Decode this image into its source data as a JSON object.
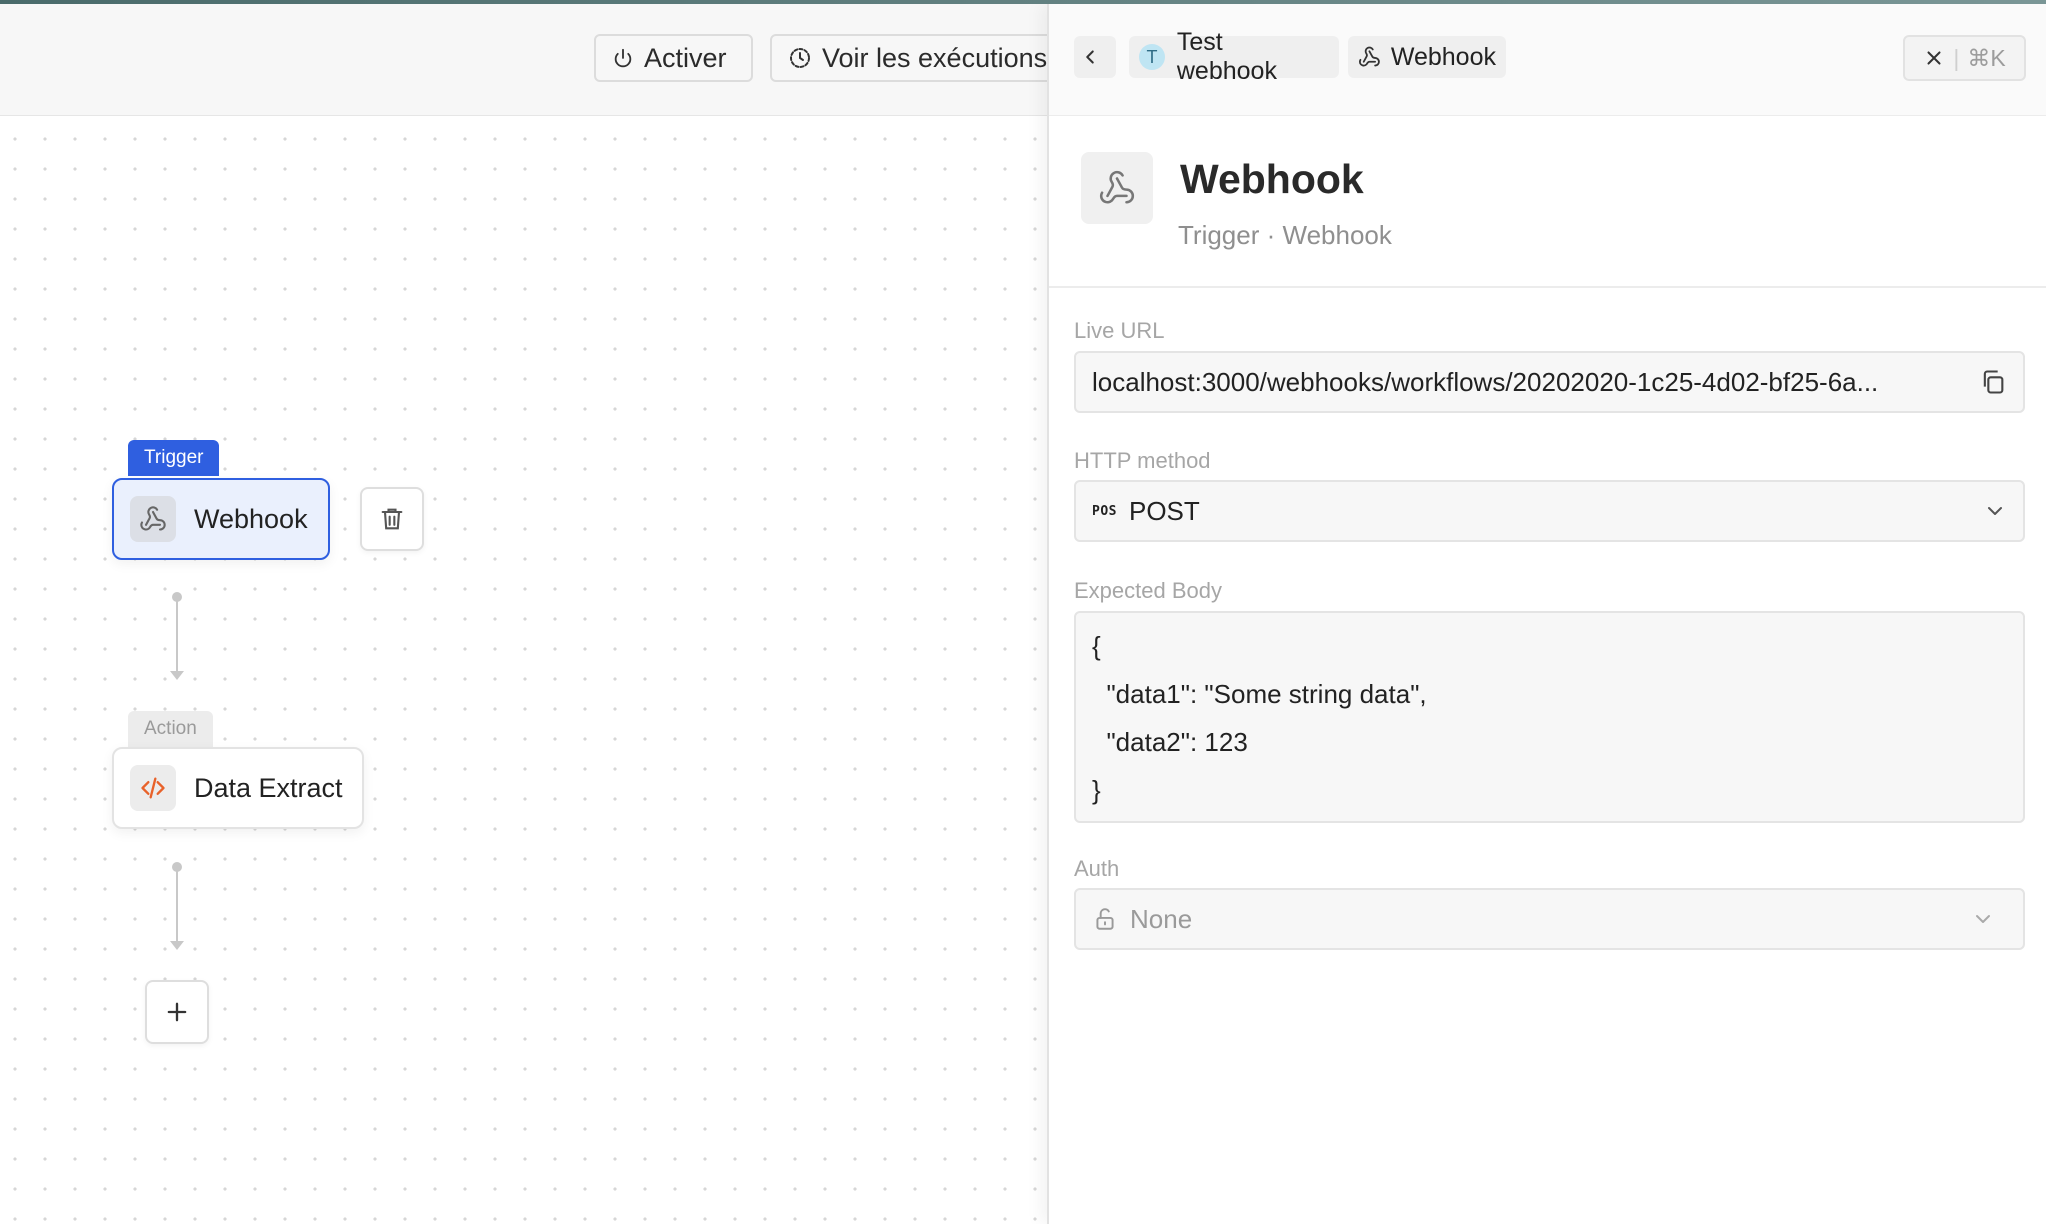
{
  "toolbar": {
    "activate_label": "Activer",
    "executions_label": "Voir les exécutions"
  },
  "canvas": {
    "trigger_tag": "Trigger",
    "trigger_node_label": "Webhook",
    "action_tag": "Action",
    "action_node_label": "Data Extract"
  },
  "panel": {
    "breadcrumb": {
      "workflow_initial": "T",
      "workflow_name": "Test webhook",
      "node_name": "Webhook"
    },
    "close_shortcut": "⌘K",
    "title": "Webhook",
    "subtitle": "Trigger · Webhook",
    "live_url": {
      "label": "Live URL",
      "value": "localhost:3000/webhooks/workflows/20202020-1c25-4d02-bf25-6a..."
    },
    "http_method": {
      "label": "HTTP method",
      "badge": "POS",
      "value": "POST"
    },
    "expected_body": {
      "label": "Expected Body",
      "lines": [
        "{",
        "  \"data1\": \"Some string data\",",
        "  \"data2\": 123",
        "}"
      ]
    },
    "auth": {
      "label": "Auth",
      "value": "None"
    }
  },
  "colors": {
    "trigger_accent": "#2f5fe0",
    "code_icon": "#e8622a"
  }
}
